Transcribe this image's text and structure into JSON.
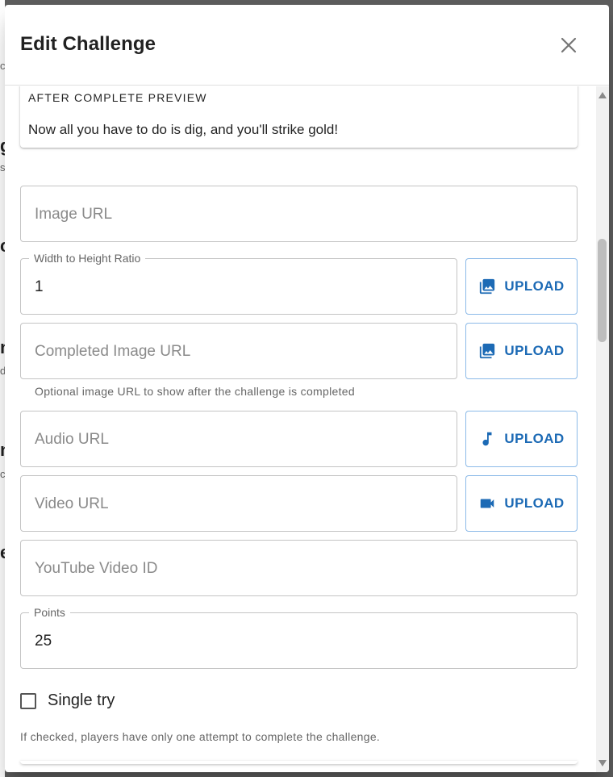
{
  "dialog": {
    "title": "Edit Challenge",
    "close_icon": "close-icon"
  },
  "preview": {
    "heading": "AFTER COMPLETE PREVIEW",
    "text": "Now all you have to do is dig, and you'll strike gold!"
  },
  "fields": {
    "image_url": {
      "placeholder": "Image URL",
      "value": ""
    },
    "ratio": {
      "label": "Width to Height Ratio",
      "value": "1"
    },
    "completed_image_url": {
      "placeholder": "Completed Image URL",
      "value": "",
      "helper": "Optional image URL to show after the challenge is completed"
    },
    "audio_url": {
      "placeholder": "Audio URL",
      "value": ""
    },
    "video_url": {
      "placeholder": "Video URL",
      "value": ""
    },
    "youtube_id": {
      "placeholder": "YouTube Video ID",
      "value": ""
    },
    "points": {
      "label": "Points",
      "value": "25"
    }
  },
  "buttons": {
    "upload_label": "UPLOAD",
    "image_icon": "image-icon",
    "audio_icon": "music-note-icon",
    "video_icon": "videocam-icon"
  },
  "single_try": {
    "label": "Single try",
    "checked": false,
    "helper": "If checked, players have only one attempt to complete the challenge."
  },
  "background_glyphs": [
    "g",
    "s",
    "c",
    "n",
    "d",
    "n",
    "c",
    "e"
  ],
  "colors": {
    "accent": "#1c6ab5",
    "backdrop": "#5e5e5e"
  }
}
